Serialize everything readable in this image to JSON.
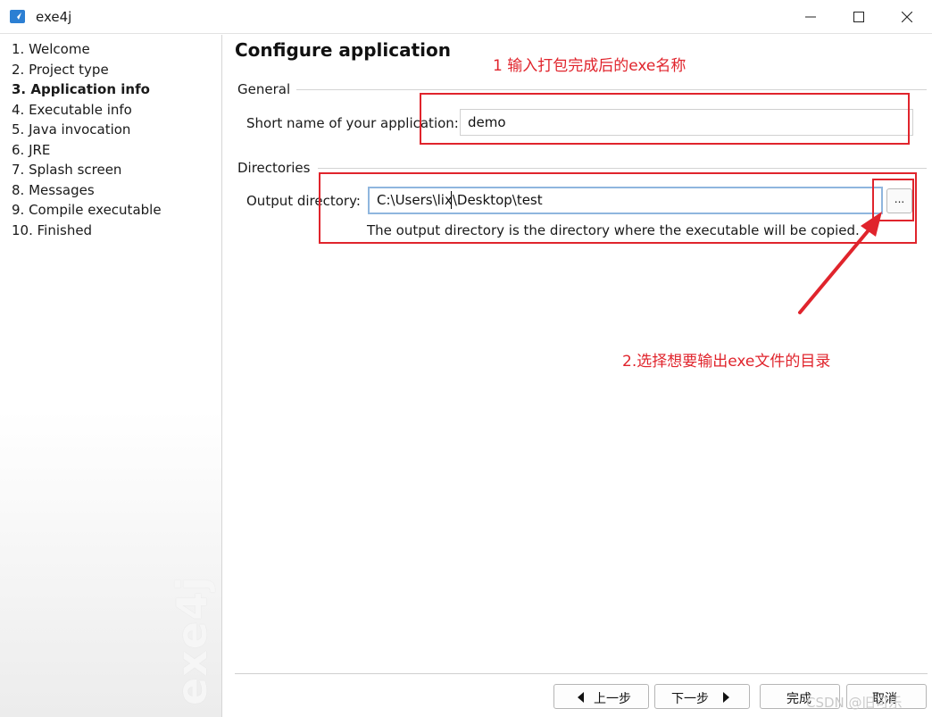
{
  "window": {
    "title": "exe4j"
  },
  "sidebar": {
    "steps": [
      {
        "label": "1. Welcome"
      },
      {
        "label": "2. Project type"
      },
      {
        "label": "3. Application info"
      },
      {
        "label": "4. Executable info"
      },
      {
        "label": "5. Java invocation"
      },
      {
        "label": "6. JRE"
      },
      {
        "label": "7. Splash screen"
      },
      {
        "label": "8. Messages"
      },
      {
        "label": "9. Compile executable"
      },
      {
        "label": "10. Finished"
      }
    ],
    "active_step": "3. Application info",
    "watermark": "exe4j"
  },
  "main": {
    "title": "Configure application",
    "general": {
      "section_label": "General",
      "short_name_label": "Short name of your application:",
      "short_name_value": "demo"
    },
    "directories": {
      "section_label": "Directories",
      "output_label": "Output directory:",
      "output_value": "C:\\Users\\lix\\Desktop\\test",
      "browse_label": "...",
      "help_text": "The output directory is the directory where the executable will be copied."
    }
  },
  "annotations": {
    "note1": "1  输入打包完成后的exe名称",
    "note2": "2.选择想要输出exe文件的目录",
    "color": "#e0242c"
  },
  "footer": {
    "back": "上一步",
    "next": "下一步",
    "finish": "完成",
    "cancel": "取消"
  },
  "watermark_csdn": "CSDN @旧可乐"
}
